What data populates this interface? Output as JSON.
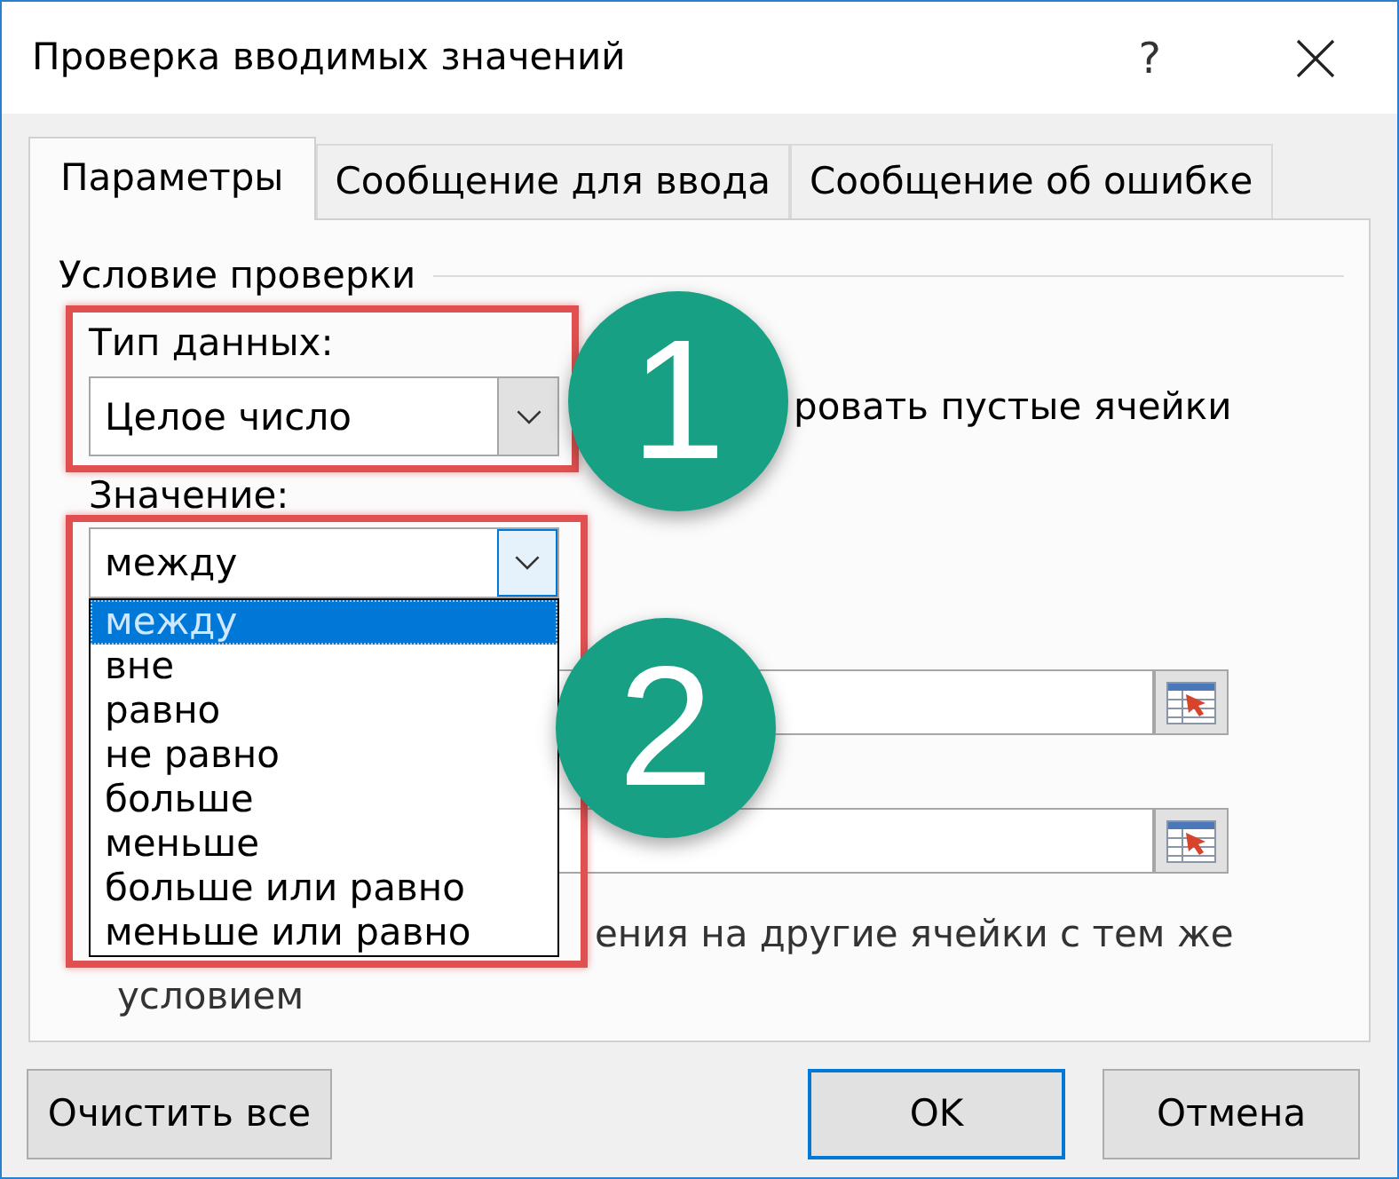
{
  "window": {
    "title": "Проверка вводимых значений",
    "help": "?"
  },
  "tabs": [
    {
      "label": "Параметры",
      "selected": true
    },
    {
      "label": "Сообщение для ввода",
      "selected": false
    },
    {
      "label": "Сообщение об ошибке",
      "selected": false
    }
  ],
  "group": {
    "title": "Условие проверки"
  },
  "data_type": {
    "label": "Тип данных:",
    "value": "Целое число",
    "expanded": false
  },
  "ignore_blank": {
    "label": "ровать пустые ячейки"
  },
  "comparison": {
    "label": "Значение:",
    "value": "между",
    "expanded": true,
    "options": [
      {
        "label": "между",
        "selected": true
      },
      {
        "label": "вне",
        "selected": false
      },
      {
        "label": "равно",
        "selected": false
      },
      {
        "label": "не равно",
        "selected": false
      },
      {
        "label": "больше",
        "selected": false
      },
      {
        "label": "меньше",
        "selected": false
      },
      {
        "label": "больше или равно",
        "selected": false
      },
      {
        "label": "меньше или равно",
        "selected": false
      }
    ]
  },
  "apply_to_all": {
    "line_1": "ения на другие ячейки с тем же",
    "line_2": "условием"
  },
  "annotations": [
    {
      "number": "1"
    },
    {
      "number": "2"
    }
  ],
  "buttons": [
    {
      "label": "Очистить все",
      "default": false
    },
    {
      "label": "OK",
      "default": true
    },
    {
      "label": "Отмена",
      "default": false
    }
  ]
}
